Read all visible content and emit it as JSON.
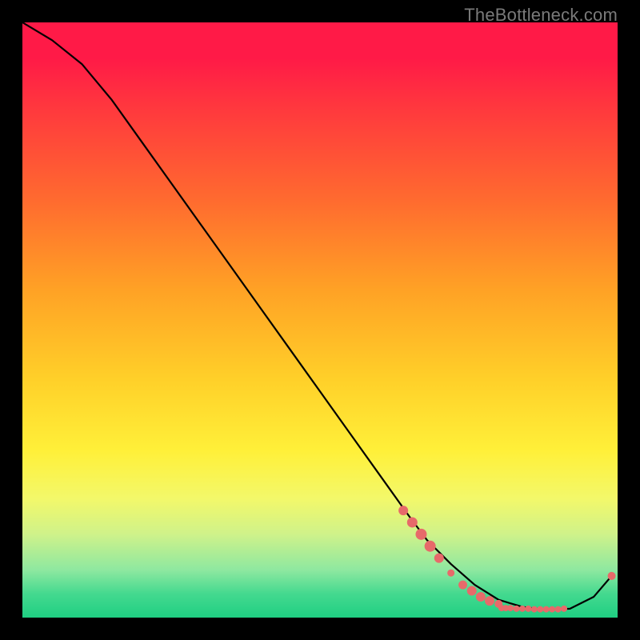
{
  "attribution": "TheBottleneck.com",
  "chart_data": {
    "type": "line",
    "title": "",
    "xlabel": "",
    "ylabel": "",
    "xlim": [
      0,
      100
    ],
    "ylim": [
      0,
      100
    ],
    "series": [
      {
        "name": "bottleneck-curve",
        "x": [
          0,
          5,
          10,
          15,
          20,
          25,
          30,
          35,
          40,
          45,
          50,
          55,
          60,
          65,
          68,
          72,
          76,
          80,
          84,
          88,
          92,
          96,
          99
        ],
        "y": [
          100,
          97,
          93,
          87,
          80,
          73,
          66,
          59,
          52,
          45,
          38,
          31,
          24,
          17,
          13,
          9,
          5.5,
          3,
          1.8,
          1.3,
          1.5,
          3.5,
          7
        ]
      }
    ],
    "markers": [
      {
        "name": "highlighted-points",
        "color": "#e76a6a",
        "points": [
          {
            "x": 64,
            "y": 18,
            "r": 6
          },
          {
            "x": 65.5,
            "y": 16,
            "r": 6.5
          },
          {
            "x": 67,
            "y": 14,
            "r": 7
          },
          {
            "x": 68.5,
            "y": 12,
            "r": 7
          },
          {
            "x": 70,
            "y": 10,
            "r": 6
          },
          {
            "x": 72,
            "y": 7.5,
            "r": 4.5
          },
          {
            "x": 74,
            "y": 5.5,
            "r": 5.5
          },
          {
            "x": 75.5,
            "y": 4.5,
            "r": 6
          },
          {
            "x": 77,
            "y": 3.5,
            "r": 6
          },
          {
            "x": 78.5,
            "y": 2.8,
            "r": 6
          },
          {
            "x": 80,
            "y": 2.3,
            "r": 5
          },
          {
            "x": 80.5,
            "y": 1.6,
            "r": 4
          },
          {
            "x": 81.2,
            "y": 1.6,
            "r": 4
          },
          {
            "x": 82,
            "y": 1.6,
            "r": 4
          },
          {
            "x": 83,
            "y": 1.5,
            "r": 4
          },
          {
            "x": 84,
            "y": 1.5,
            "r": 4
          },
          {
            "x": 85,
            "y": 1.5,
            "r": 4
          },
          {
            "x": 86,
            "y": 1.4,
            "r": 4
          },
          {
            "x": 87,
            "y": 1.4,
            "r": 4
          },
          {
            "x": 88,
            "y": 1.4,
            "r": 4
          },
          {
            "x": 89,
            "y": 1.4,
            "r": 4
          },
          {
            "x": 90,
            "y": 1.4,
            "r": 4
          },
          {
            "x": 91,
            "y": 1.5,
            "r": 4
          },
          {
            "x": 99,
            "y": 7,
            "r": 5
          }
        ]
      }
    ]
  }
}
